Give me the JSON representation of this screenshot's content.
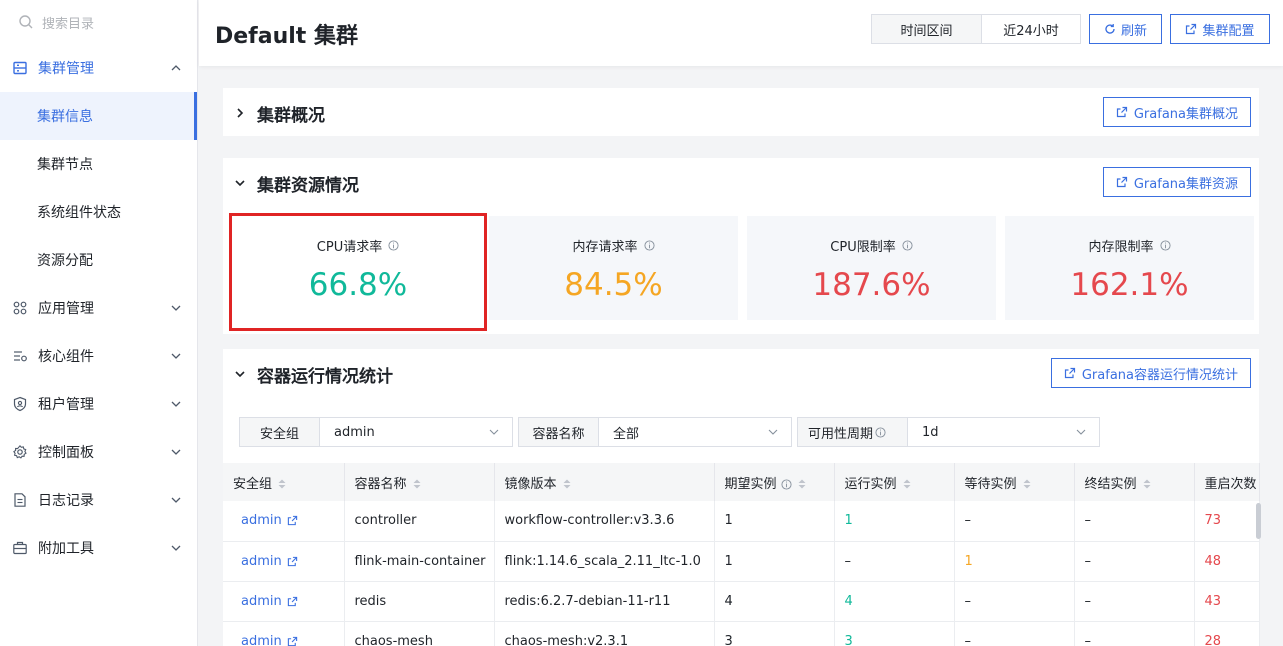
{
  "sidebar": {
    "search_placeholder": "搜索目录",
    "groups": [
      {
        "label": "集群管理",
        "icon": "cluster-icon",
        "expanded": true,
        "items": [
          {
            "label": "集群信息",
            "active": true
          },
          {
            "label": "集群节点"
          },
          {
            "label": "系统组件状态"
          },
          {
            "label": "资源分配"
          }
        ]
      },
      {
        "label": "应用管理",
        "icon": "apps-icon"
      },
      {
        "label": "核心组件",
        "icon": "core-icon"
      },
      {
        "label": "租户管理",
        "icon": "tenant-icon"
      },
      {
        "label": "控制面板",
        "icon": "gear-icon"
      },
      {
        "label": "日志记录",
        "icon": "log-icon"
      },
      {
        "label": "附加工具",
        "icon": "toolbox-icon"
      }
    ]
  },
  "header": {
    "title": "Default 集群",
    "time_range_label": "时间区间",
    "time_range_value": "近24小时",
    "refresh_label": "刷新",
    "config_label": "集群配置"
  },
  "overview": {
    "title": "集群概况",
    "grafana_label": "Grafana集群概况"
  },
  "resources": {
    "title": "集群资源情况",
    "grafana_label": "Grafana集群资源",
    "cards": [
      {
        "title": "CPU请求率",
        "value": "66.8%",
        "color": "#10b99a"
      },
      {
        "title": "内存请求率",
        "value": "84.5%",
        "color": "#f5a623"
      },
      {
        "title": "CPU限制率",
        "value": "187.6%",
        "color": "#e5484d"
      },
      {
        "title": "内存限制率",
        "value": "162.1%",
        "color": "#e5484d"
      }
    ]
  },
  "containers": {
    "title": "容器运行情况统计",
    "grafana_label": "Grafana容器运行情况统计",
    "filters": [
      {
        "label": "安全组",
        "value": "admin"
      },
      {
        "label": "容器名称",
        "value": "全部"
      },
      {
        "label": "可用性周期",
        "value": "1d"
      }
    ],
    "columns": [
      "安全组",
      "容器名称",
      "镜像版本",
      "期望实例",
      "运行实例",
      "等待实例",
      "终结实例",
      "重启次数"
    ],
    "rows": [
      {
        "group": "admin",
        "name": "controller",
        "image": "workflow-controller:v3.3.6",
        "desired": "1",
        "running": "1",
        "pending": "–",
        "terminated": "–",
        "restarts": "73"
      },
      {
        "group": "admin",
        "name": "flink-main-container",
        "image": "flink:1.14.6_scala_2.11_ltc-1.0",
        "desired": "1",
        "running": "–",
        "pending": "1",
        "terminated": "–",
        "restarts": "48"
      },
      {
        "group": "admin",
        "name": "redis",
        "image": "redis:6.2.7-debian-11-r11",
        "desired": "4",
        "running": "4",
        "pending": "–",
        "terminated": "–",
        "restarts": "43"
      },
      {
        "group": "admin",
        "name": "chaos-mesh",
        "image": "chaos-mesh:v2.3.1",
        "desired": "3",
        "running": "3",
        "pending": "–",
        "terminated": "–",
        "restarts": "28"
      }
    ]
  }
}
